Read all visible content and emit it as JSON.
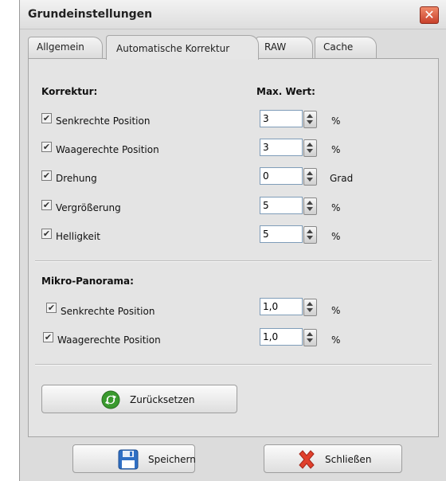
{
  "dialog": {
    "title": "Grundeinstellungen",
    "close_glyph": "✕"
  },
  "tabs": [
    {
      "label": "Allgemein",
      "active": false
    },
    {
      "label": "Automatische Korrektur",
      "active": true
    },
    {
      "label": "RAW",
      "active": false
    },
    {
      "label": "Cache",
      "active": false
    }
  ],
  "korrektur": {
    "heading": "Korrektur:",
    "max_heading": "Max. Wert:",
    "rows": [
      {
        "label": "Senkrechte Position",
        "checked": true,
        "value": "3",
        "unit": "%"
      },
      {
        "label": "Waagerechte Position",
        "checked": true,
        "value": "3",
        "unit": "%"
      },
      {
        "label": "Drehung",
        "checked": true,
        "value": "0",
        "unit": "Grad"
      },
      {
        "label": "Vergrößerung",
        "checked": true,
        "value": "5",
        "unit": "%"
      },
      {
        "label": "Helligkeit",
        "checked": true,
        "value": "5",
        "unit": "%"
      }
    ]
  },
  "panorama": {
    "heading": "Mikro-Panorama:",
    "rows": [
      {
        "label": "Senkrechte Position",
        "checked": true,
        "value": "1,0",
        "unit": "%"
      },
      {
        "label": "Waagerechte Position",
        "checked": true,
        "value": "1,0",
        "unit": "%"
      }
    ]
  },
  "buttons": {
    "reset": "Zurücksetzen",
    "save": "Speichern",
    "close": "Schließen"
  },
  "icons": {
    "reset": "recycle-icon",
    "save": "floppy-disk-icon",
    "close": "red-x-icon",
    "check": "✔"
  },
  "colors": {
    "accent_close": "#c8402a",
    "input_border": "#7f9db9",
    "reset_green": "#3a9a2e",
    "save_blue": "#2f6fc4"
  }
}
